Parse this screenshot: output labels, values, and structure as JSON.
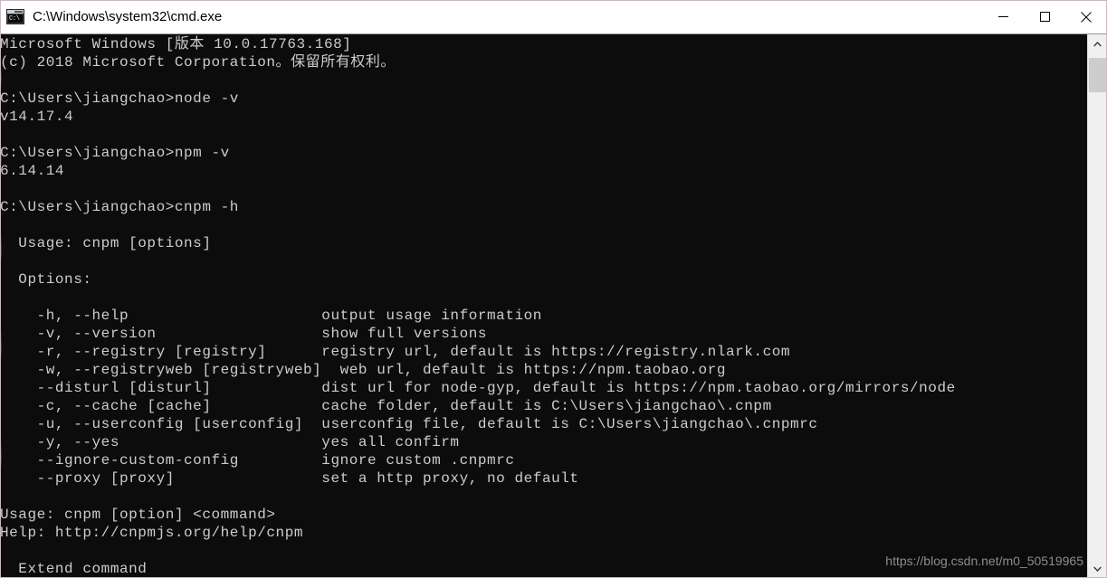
{
  "window": {
    "title": "C:\\Windows\\system32\\cmd.exe",
    "icon_name": "cmd-console-icon",
    "icon_glyph": "C:\\",
    "controls": {
      "minimize_label": "Minimize",
      "maximize_label": "Maximize",
      "close_label": "Close"
    },
    "colors": {
      "titlebar_background": "#ffffff",
      "titlebar_text": "#000000",
      "console_background": "#0c0c0c",
      "console_text": "#cccccc",
      "scrollbar_track": "#f0f0f0",
      "scrollbar_thumb": "#cdcdcd",
      "watermark_text": "#8d8d8d"
    }
  },
  "scrollbar": {
    "up_arrow_label": "Scroll up",
    "down_arrow_label": "Scroll down",
    "thumb_label": "Scroll thumb"
  },
  "watermark": {
    "text": "https://blog.csdn.net/m0_50519965"
  },
  "terminal": {
    "prompt_user_path": "C:\\Users\\jiangchao>",
    "commands": [
      "node -v",
      "npm -v",
      "cnpm -h"
    ],
    "versions": {
      "node": "v14.17.4",
      "npm": "6.14.14"
    },
    "lines": [
      "Microsoft Windows [版本 10.0.17763.168]",
      "(c) 2018 Microsoft Corporation。保留所有权利。",
      "",
      "C:\\Users\\jiangchao>node -v",
      "v14.17.4",
      "",
      "C:\\Users\\jiangchao>npm -v",
      "6.14.14",
      "",
      "C:\\Users\\jiangchao>cnpm -h",
      "",
      "  Usage: cnpm [options]",
      "",
      "  Options:",
      "",
      "    -h, --help                     output usage information",
      "    -v, --version                  show full versions",
      "    -r, --registry [registry]      registry url, default is https://registry.nlark.com",
      "    -w, --registryweb [registryweb]  web url, default is https://npm.taobao.org",
      "    --disturl [disturl]            dist url for node-gyp, default is https://npm.taobao.org/mirrors/node",
      "    -c, --cache [cache]            cache folder, default is C:\\Users\\jiangchao\\.cnpm",
      "    -u, --userconfig [userconfig]  userconfig file, default is C:\\Users\\jiangchao\\.cnpmrc",
      "    -y, --yes                      yes all confirm",
      "    --ignore-custom-config         ignore custom .cnpmrc",
      "    --proxy [proxy]                set a http proxy, no default",
      "",
      "Usage: cnpm [option] <command>",
      "Help: http://cnpmjs.org/help/cnpm",
      "",
      "  Extend command"
    ],
    "options": [
      {
        "flags": "-h, --help",
        "description": "output usage information"
      },
      {
        "flags": "-v, --version",
        "description": "show full versions"
      },
      {
        "flags": "-r, --registry [registry]",
        "description": "registry url, default is https://registry.nlark.com"
      },
      {
        "flags": "-w, --registryweb [registryweb]",
        "description": "web url, default is https://npm.taobao.org"
      },
      {
        "flags": "--disturl [disturl]",
        "description": "dist url for node-gyp, default is https://npm.taobao.org/mirrors/node"
      },
      {
        "flags": "-c, --cache [cache]",
        "description": "cache folder, default is C:\\Users\\jiangchao\\.cnpm"
      },
      {
        "flags": "-u, --userconfig [userconfig]",
        "description": "userconfig file, default is C:\\Users\\jiangchao\\.cnpmrc"
      },
      {
        "flags": "-y, --yes",
        "description": "yes all confirm"
      },
      {
        "flags": "--ignore-custom-config",
        "description": "ignore custom .cnpmrc"
      },
      {
        "flags": "--proxy [proxy]",
        "description": "set a http proxy, no default"
      }
    ],
    "usage_line": "Usage: cnpm [option] <command>",
    "help_line": "Help: http://cnpmjs.org/help/cnpm",
    "extend_command_heading": "Extend command"
  }
}
